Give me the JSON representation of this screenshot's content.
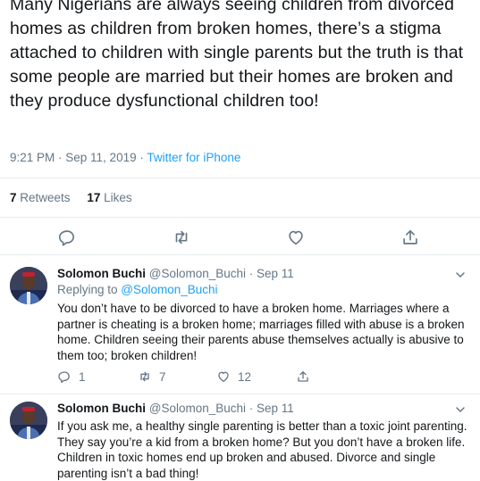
{
  "tweet": {
    "text": "Many Nigerians are always seeing children from divorced homes as children from broken homes, there’s a stigma attached to children with single parents but the truth is that some people are married but their homes are broken and they produce dysfunctional children too!",
    "time": "9:21 PM · Sep 11, 2019 · ",
    "source": "Twitter for iPhone",
    "retweets_count": "7",
    "retweets_label": "Retweets",
    "likes_count": "17",
    "likes_label": "Likes"
  },
  "icons": {
    "reply": "reply-icon",
    "retweet": "retweet-icon",
    "like": "heart-icon",
    "share": "share-icon",
    "more": "chevron-down-icon"
  },
  "colors": {
    "accent": "#1da1f2",
    "muted": "#657786",
    "text": "#14171a",
    "border": "#e6ecf0"
  },
  "replies": [
    {
      "name": "Solomon Buchi",
      "handle": "@Solomon_Buchi",
      "sep": " · ",
      "date": "Sep 11",
      "replying_label": "Replying to ",
      "replying_to": "@Solomon_Buchi",
      "text": "You don’t have to be divorced to have a broken home. Marriages where a partner is cheating is a broken home; marriages filled with abuse is a broken home. Children seeing their parents abuse themselves actually is abusive to them too; broken children!",
      "reply_count": "1",
      "retweet_count": "7",
      "like_count": "12"
    },
    {
      "name": "Solomon Buchi",
      "handle": "@Solomon_Buchi",
      "sep": " · ",
      "date": "Sep 11",
      "text": "If you ask me, a healthy single parenting is better than a toxic joint parenting. They say you’re a kid from a broken home? But you don’t have a broken life. Children in toxic homes end up broken and abused. Divorce and single parenting isn’t a bad thing!"
    }
  ]
}
